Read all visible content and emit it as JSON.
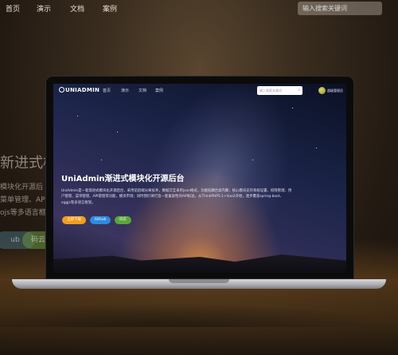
{
  "background_site": {
    "nav": [
      "首页",
      "演示",
      "文档",
      "案例"
    ],
    "search_placeholder": "输入搜索关键词",
    "title_fragment": "新进式模",
    "desc_fragments": [
      "模块化开源后",
      "菜单管理、AP",
      "ojs等多语言框"
    ],
    "pill_fragments": [
      "ub",
      "码云"
    ]
  },
  "screen": {
    "logo": "UNIADMIN",
    "nav": [
      "首页",
      "演示",
      "文档",
      "案例"
    ],
    "search_placeholder": "输入搜索关键词",
    "user_name": "超级管理员",
    "hero_title": "UniAdmin渐进式模块化开源后台",
    "hero_desc": "UniAdmin是一套渐进式模块化开源后台，采用前后端分离技术，数据交互采用json格式，功能低耦合高内聚；核心模块支持系统设置、权限管理、用户管理、菜单管理、API管理等功能，模块市场；同时我们将打造一套兼容性的API标准，从ThinkPHP5.1+Vue2开始，逐步覆盖spring-boot、eggjs等多语言框架。",
    "buttons": {
      "download": "立即下载",
      "github": "Github",
      "gitee": "码云"
    }
  },
  "colors": {
    "download": "#f29d1f",
    "github": "#2f8ae0",
    "gitee": "#5aa63c"
  }
}
